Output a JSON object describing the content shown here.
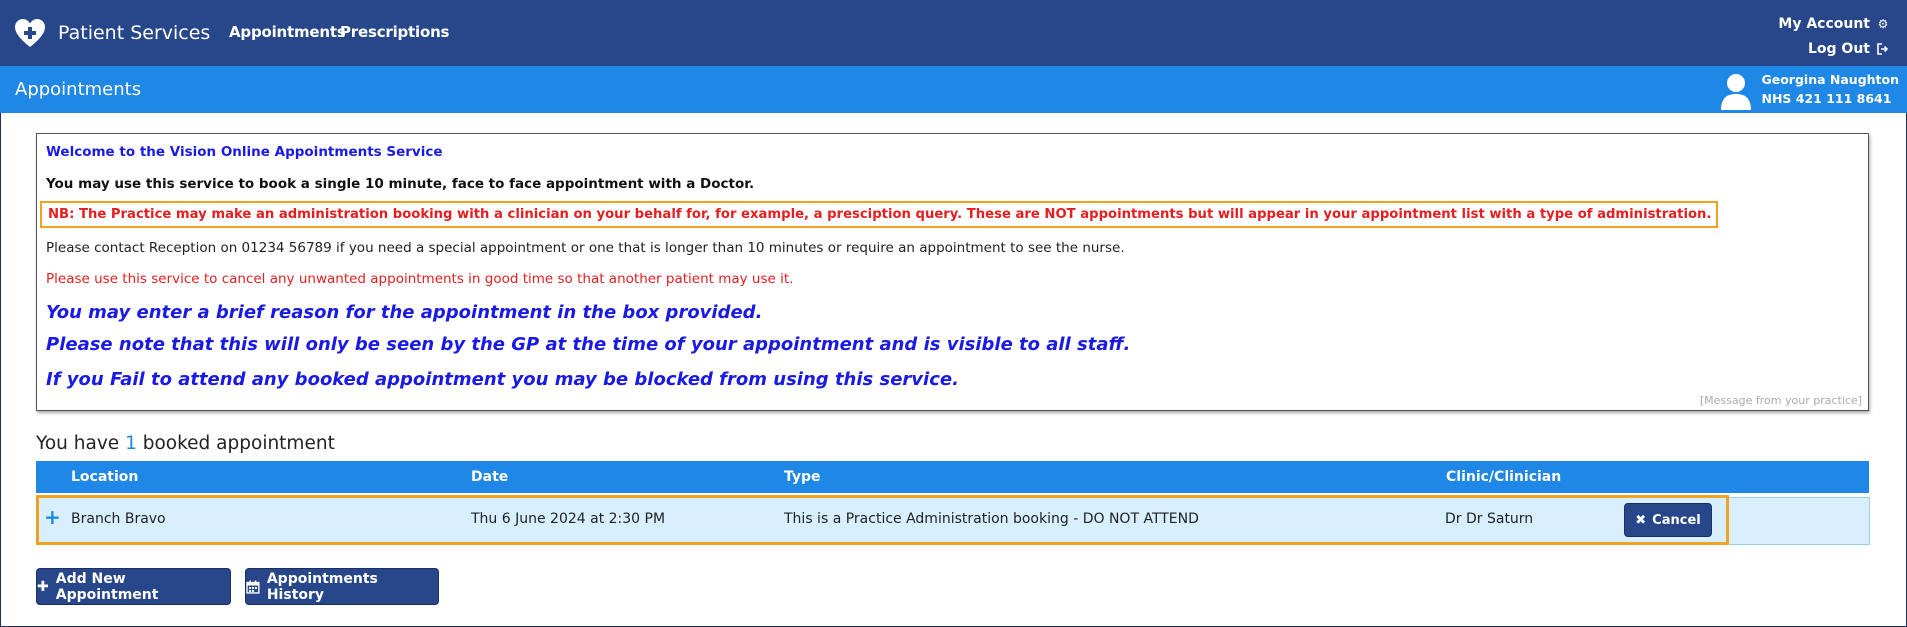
{
  "nav": {
    "brand": "Patient Services",
    "links": [
      "Appointments",
      "Prescriptions"
    ],
    "my_account": "My Account",
    "log_out": "Log Out"
  },
  "subheader": {
    "title": "Appointments",
    "user_name": "Georgina Naughton",
    "nhs_number": "NHS 421 111 8641"
  },
  "message": {
    "lines": [
      "Welcome to the Vision Online Appointments Service",
      "You may use this service to book a single 10 minute, face to face appointment with a Doctor.",
      "NB: The Practice may make an administration booking with a clinician on your behalf for, for example, a presciption query. These are NOT appointments but will appear in your appointment list with a type of administration.",
      "Please contact Reception on 01234 56789 if you need a special appointment or one that is longer than 10 minutes or require an appointment to see the nurse.",
      "Please use this service to cancel any unwanted appointments in good time so that another patient may use it.",
      "You may enter a brief reason for the appointment in the box provided.",
      "Please note that this will only be seen by the GP at the time of your appointment and is visible to all staff.",
      "If you Fail to attend any booked appointment you may be blocked from using this service."
    ],
    "source": "[Message from your practice]"
  },
  "booked": {
    "prefix": "You have",
    "count": "1",
    "suffix": "booked appointment"
  },
  "table": {
    "columns": [
      "Location",
      "Date",
      "Type",
      "Clinic/Clinician"
    ],
    "rows": [
      {
        "location": "Branch Bravo",
        "date": "Thu 6 June 2024 at 2:30 PM",
        "type": "This is a Practice Administration booking - DO NOT ATTEND",
        "clinician": "Dr Dr Saturn",
        "action": "Cancel"
      }
    ]
  },
  "buttons": {
    "add": "Add New Appointment",
    "history": "Appointments History"
  },
  "colors": {
    "nav_bg": "#27478a",
    "subheader_bg": "#1f87e5",
    "highlight": "#f0a320",
    "alert_red": "#e51f1f",
    "info_blue": "#1a1ae6",
    "row_bg": "#d8efff"
  }
}
